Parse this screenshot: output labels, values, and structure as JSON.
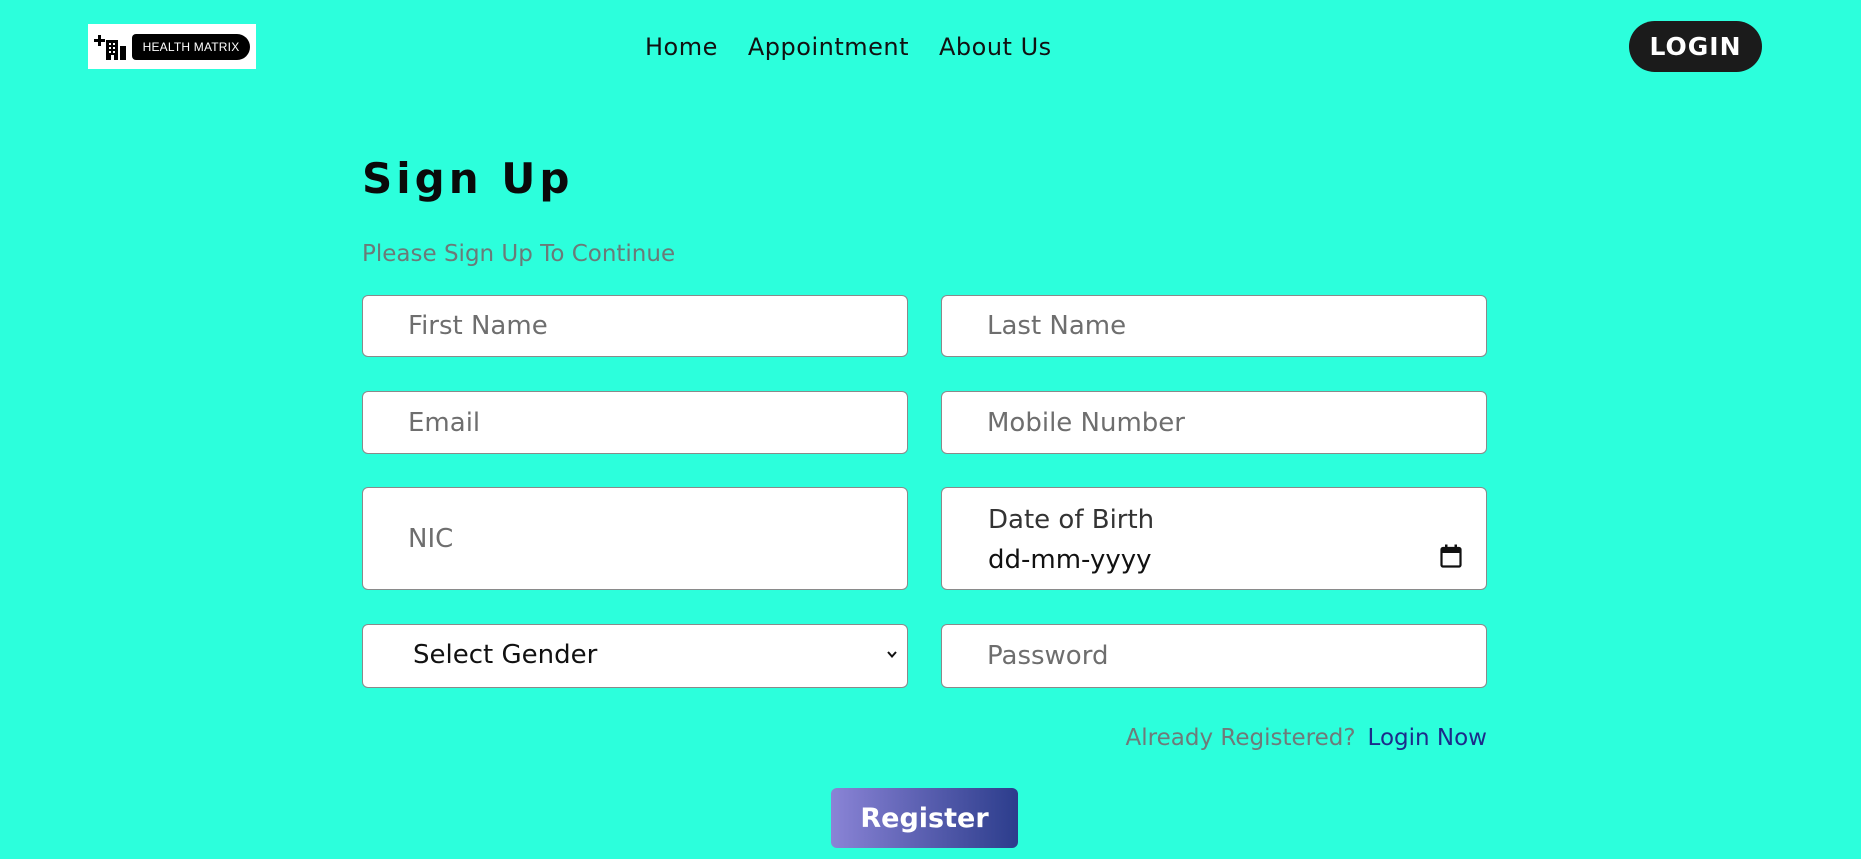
{
  "brand": {
    "logo_text": "HEALTH MATRIX",
    "logo_icon": "hospital-icon"
  },
  "nav": {
    "items": [
      {
        "label": "Home"
      },
      {
        "label": "Appointment"
      },
      {
        "label": "About Us"
      }
    ],
    "login_label": "LOGIN"
  },
  "form": {
    "title": "Sign Up",
    "subtitle": "Please Sign Up To Continue",
    "first_name": {
      "placeholder": "First Name",
      "value": ""
    },
    "last_name": {
      "placeholder": "Last Name",
      "value": ""
    },
    "email": {
      "placeholder": "Email",
      "value": ""
    },
    "mobile": {
      "placeholder": "Mobile Number",
      "value": ""
    },
    "nic": {
      "placeholder": "NIC",
      "value": ""
    },
    "dob": {
      "label": "Date of Birth",
      "value": "dd-mm-yyyy",
      "icon": "calendar-icon"
    },
    "gender": {
      "selected": "Select Gender",
      "icon": "chevron-down-icon"
    },
    "password": {
      "placeholder": "Password",
      "value": ""
    },
    "already_registered": "Already Registered?",
    "login_now": "Login Now",
    "register_label": "Register"
  },
  "colors": {
    "background": "#2cffdc",
    "login_button": "#1b1b1b",
    "register_gradient_start": "#8a84d6",
    "register_gradient_end": "#2c3d8c",
    "link": "#1d2b8a",
    "muted_text": "#6f7a79"
  }
}
